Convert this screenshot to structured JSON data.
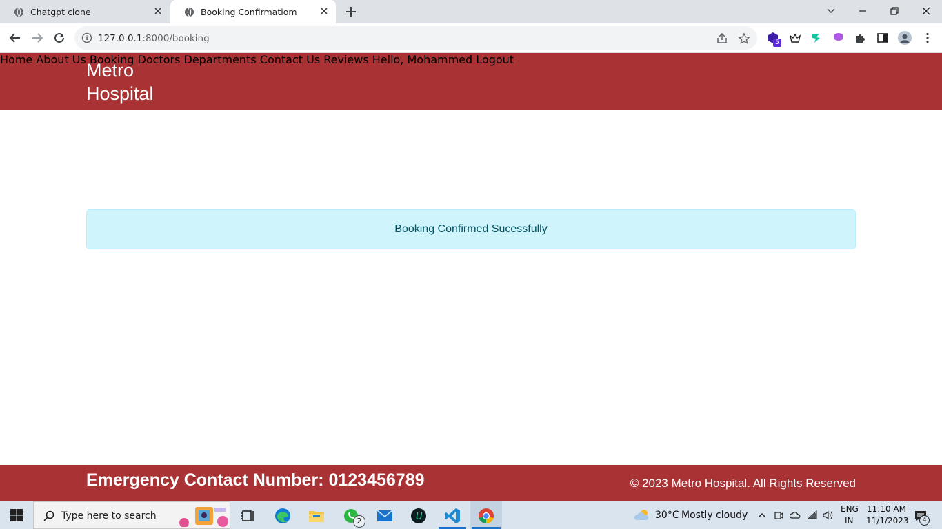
{
  "browser": {
    "tabs": [
      {
        "title": "Chatgpt clone"
      },
      {
        "title": "Booking Confirmatiom"
      }
    ],
    "url_host": "127.0.0.1",
    "url_path": ":8000/booking",
    "extension_badge": "5"
  },
  "site": {
    "brand_line1": "Metro",
    "brand_line2": "Hospital",
    "nav": {
      "home": "Home",
      "about": "About Us",
      "booking": "Booking",
      "doctors": "Doctors",
      "departments": "Departments",
      "contact": "Contact Us",
      "reviews": "Reviews",
      "greeting": "Hello, Mohammed",
      "logout": "Logout"
    },
    "alert_message": "Booking Confirmed Sucessfully",
    "footer": {
      "emergency": "Emergency Contact Number: 0123456789",
      "copyright": "© 2023 Metro Hospital. All Rights Reserved"
    },
    "colors": {
      "brand": "#a83234",
      "alert_bg": "#cff4fc",
      "alert_text": "#055160"
    }
  },
  "taskbar": {
    "search_placeholder": "Type here to search",
    "whatsapp_badge": "2",
    "weather_temp": "30°C",
    "weather_desc": "Mostly cloudy",
    "lang_line1": "ENG",
    "lang_line2": "IN",
    "time": "11:10 AM",
    "date": "11/1/2023",
    "notification_count": "4"
  }
}
